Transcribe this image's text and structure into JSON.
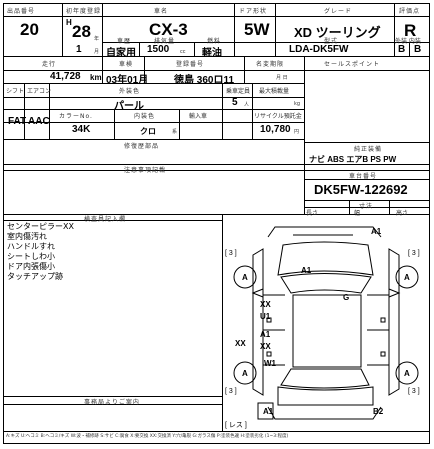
{
  "header": {
    "lot_label": "出品番号",
    "year_label": "初年度登録",
    "car_name_label": "車名",
    "door_label": "ドア形状",
    "grade_label": "グレード",
    "eval_label": "評価点",
    "lot_number": "20",
    "era": "H",
    "year": "28",
    "year_unit": "年",
    "month": "1",
    "month_unit": "月",
    "car_name": "CX-3",
    "door": "5W",
    "grade": "XD ツーリング",
    "usage_label": "車歴",
    "displacement_label": "排気量",
    "fuel_label": "燃料",
    "model_label": "型式",
    "usage": "自家用",
    "displacement": "1500",
    "displacement_unit": "cc",
    "fuel": "軽油",
    "model_code": "LDA-DK5FW",
    "score": "R",
    "ext_int_label": "外装 内装",
    "exterior_grade": "B",
    "interior_grade": "B"
  },
  "specs": {
    "mileage_label": "走行",
    "inspection_label": "車検",
    "reg_label": "登録番号",
    "transfer_label": "名変期限",
    "selling_label": "セールスポイント",
    "mileage": "41,728",
    "mileage_unit": "km",
    "inspection": "03年01月",
    "registration": "徳島 360ロ11",
    "transfer_deadline": "月 日",
    "shift_label": "シフト",
    "ac_label": "エアコン",
    "ext_color_label": "外装色",
    "capacity_label": "乗車定員",
    "load_label": "最大積載量",
    "shift": "FAT",
    "ac": "AAC",
    "ext_color": "パール",
    "capacity": "5",
    "capacity_unit": "人",
    "load_unit": "kg",
    "color_no_label": "カラーNo.",
    "int_color_label": "内装色",
    "import_label": "輸入車",
    "recycle_label": "リサイクル預託金",
    "color_no": "34K",
    "int_color": "クロ",
    "int_color_suffix": "系",
    "recycle_fee": "10,780",
    "recycle_unit": "円",
    "parts_label": "修復歴部品",
    "equipment_label": "純正装備",
    "equipment": "ナビ ABS エアB PS PW"
  },
  "notes": {
    "notes_label": "注意事項記載",
    "chassis_label": "車台番号",
    "chassis_number": "DK5FW-122692",
    "dims_label": "寸法",
    "length_label": "長さ",
    "width_label": "幅",
    "height_label": "高さ"
  },
  "inspector": {
    "label": "検査員記入欄",
    "lines": [
      "センターピラーXX",
      "室内傷汚れ",
      "ハンドルすれ",
      "シートしわ小",
      "ドア内張傷小",
      "タッチアップ跡"
    ]
  },
  "office_label": "事務局よりご案内",
  "diagram": {
    "marks": [
      "A1",
      "A1",
      "G",
      "XX",
      "U1",
      "A1",
      "XX",
      "XX",
      "W1",
      "A",
      "A",
      "A",
      "A",
      "A1",
      "B2"
    ],
    "brackets": [
      "[ 3 ]",
      "[ 3 ]",
      "[ 3 ]",
      "[ 3 ]"
    ],
    "ix_label": "[ レス ]"
  },
  "legend": "A:キズ U:ヘコミ B:ヘコミ/キズ W:波・補修跡 S:サビ C:腐食 X:要交換 XX:交換済 Y:穴/亀裂 G:ガラス傷 P:塗装色違 H:塗装劣化 (1~3:程度)"
}
